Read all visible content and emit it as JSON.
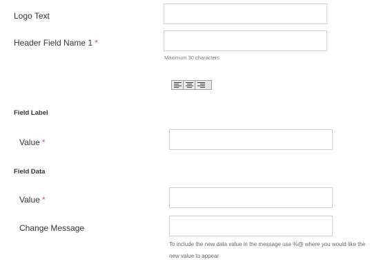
{
  "form": {
    "logo_text": {
      "label": "Logo Text",
      "value": ""
    },
    "header_field_name_1": {
      "label": "Header Field Name 1",
      "required_mark": "*",
      "value": "",
      "hint": "Maximum 30 characters"
    },
    "alignment": {
      "options": [
        "align-left-icon",
        "align-center-icon",
        "align-right-icon"
      ]
    },
    "field_label_section": {
      "title": "Field Label",
      "value_label": "Value",
      "required_mark": "*",
      "value": ""
    },
    "field_data_section": {
      "title": "Field Data",
      "value_label": "Value",
      "required_mark": "*",
      "value": "",
      "change_message_label": "Change Message",
      "change_message_value": "",
      "change_message_hint": "To include the new data value in the message use %@ where you would like the new value to appear"
    }
  },
  "colors": {
    "required": "#d9534f",
    "border": "#cfcfcf",
    "hint": "#777777"
  }
}
